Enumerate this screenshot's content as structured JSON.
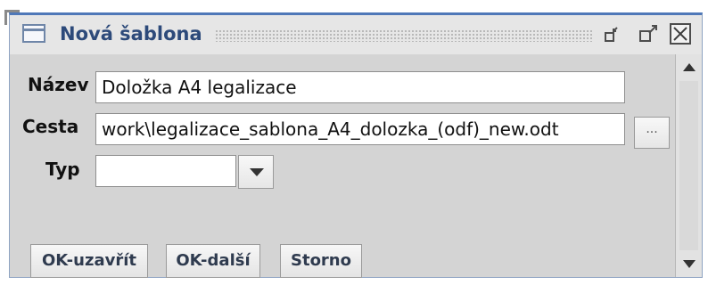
{
  "window": {
    "title": "Nová šablona",
    "icon": "window-icon",
    "controls": {
      "minimize_icon": "minimize-icon",
      "restore_icon": "restore-icon",
      "close_label": "X"
    }
  },
  "form": {
    "name_label": "Název",
    "name_value": "Doložka A4 legalizace",
    "path_label": "Cesta",
    "path_value": "work\\legalizace_sablona_A4_dolozka_(odf)_new.odt",
    "browse_label": "...",
    "type_label": "Typ",
    "type_value": ""
  },
  "buttons": {
    "ok_close": "OK-uzavřít",
    "ok_next": "OK-další",
    "cancel": "Storno"
  },
  "colors": {
    "window_bg": "#d4d4d4",
    "title_text": "#2d4a7a",
    "title_border": "#4f78b8"
  }
}
